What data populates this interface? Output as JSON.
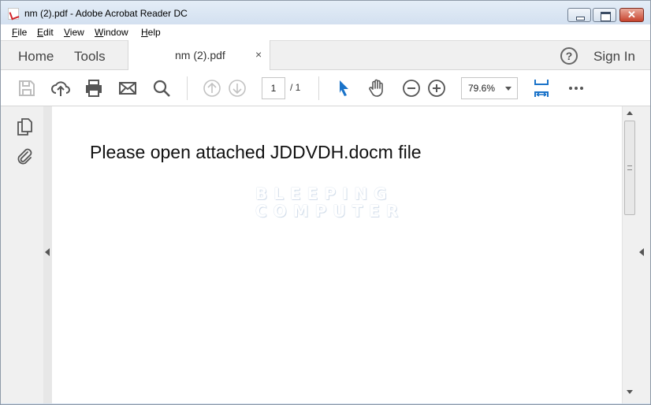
{
  "window": {
    "title": "nm (2).pdf - Adobe Acrobat Reader DC",
    "close_glyph": "✕"
  },
  "menu": [
    {
      "accel": "F",
      "rest": "ile"
    },
    {
      "accel": "E",
      "rest": "dit"
    },
    {
      "accel": "V",
      "rest": "iew"
    },
    {
      "accel": "W",
      "rest": "indow"
    },
    {
      "accel": "H",
      "rest": "elp"
    }
  ],
  "nav": {
    "home": "Home",
    "tools": "Tools",
    "sign_in": "Sign In",
    "help_glyph": "?"
  },
  "tab": {
    "label": "nm (2).pdf",
    "close": "×"
  },
  "toolbar": {
    "page_current": "1",
    "page_total": "/ 1",
    "zoom": "79.6%",
    "icons": [
      "save-icon",
      "upload-icon",
      "print-icon",
      "email-icon",
      "search-icon",
      "page-up-icon",
      "page-down-icon",
      "select-cursor-icon",
      "hand-tool-icon",
      "zoom-out-icon",
      "zoom-in-icon",
      "fit-width-icon",
      "more-icon"
    ]
  },
  "document": {
    "text": "Please open attached JDDVDH.docm file",
    "watermark_line1": "BLEEPING",
    "watermark_line2": "COMPUTER"
  },
  "colors": {
    "accent": "#1a73c9",
    "close_button": "#c7432d",
    "window_frame": "#cfdcec"
  }
}
